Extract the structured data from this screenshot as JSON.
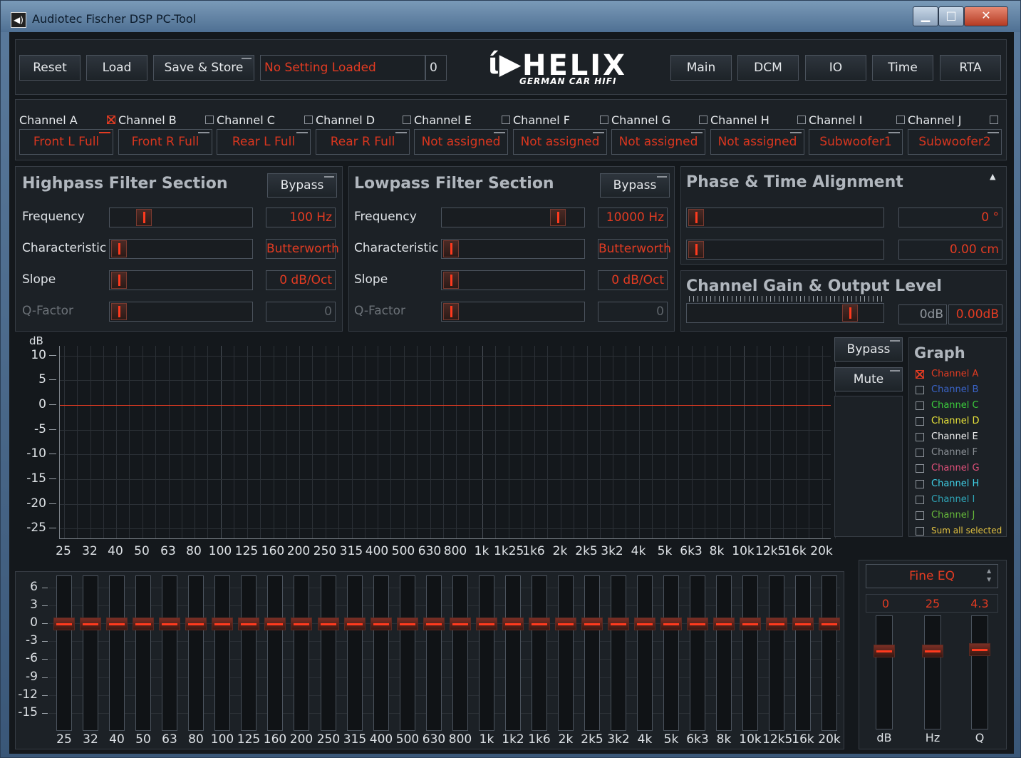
{
  "window": {
    "title": "Audiotec Fischer DSP PC-Tool",
    "minimize": "▁",
    "maximize": "□",
    "close": "✕"
  },
  "toolbar": {
    "reset": "Reset",
    "load": "Load",
    "save_store": "Save & Store",
    "setting_status": "No Setting Loaded",
    "setting_number": "0",
    "nav": [
      "Main",
      "DCM",
      "IO",
      "Time",
      "RTA"
    ]
  },
  "logo": {
    "main": "HELIX",
    "sub": "GERMAN CAR HIFI"
  },
  "channels": [
    {
      "label": "Channel A",
      "checked": true,
      "assignment": "Front L Full"
    },
    {
      "label": "Channel B",
      "checked": false,
      "assignment": "Front R Full"
    },
    {
      "label": "Channel C",
      "checked": false,
      "assignment": "Rear L Full"
    },
    {
      "label": "Channel D",
      "checked": false,
      "assignment": "Rear R Full"
    },
    {
      "label": "Channel E",
      "checked": false,
      "assignment": "Not assigned"
    },
    {
      "label": "Channel F",
      "checked": false,
      "assignment": "Not assigned"
    },
    {
      "label": "Channel G",
      "checked": false,
      "assignment": "Not assigned"
    },
    {
      "label": "Channel H",
      "checked": false,
      "assignment": "Not assigned"
    },
    {
      "label": "Channel I",
      "checked": false,
      "assignment": "Subwoofer1"
    },
    {
      "label": "Channel J",
      "checked": false,
      "assignment": "Subwoofer2"
    }
  ],
  "highpass": {
    "title": "Highpass Filter Section",
    "bypass": "Bypass",
    "rows": [
      {
        "label": "Frequency",
        "value": "100 Hz",
        "level": 0.2
      },
      {
        "label": "Characteristic",
        "value": "Butterworth",
        "level": 0
      },
      {
        "label": "Slope",
        "value": "0 dB/Oct",
        "level": 0
      },
      {
        "label": "Q-Factor",
        "value": "0",
        "level": 0
      }
    ]
  },
  "lowpass": {
    "title": "Lowpass Filter Section",
    "bypass": "Bypass",
    "rows": [
      {
        "label": "Frequency",
        "value": "10000 Hz",
        "level": 0.86
      },
      {
        "label": "Characteristic",
        "value": "Butterworth",
        "level": 0
      },
      {
        "label": "Slope",
        "value": "0 dB/Oct",
        "level": 0
      },
      {
        "label": "Q-Factor",
        "value": "0",
        "level": 0
      }
    ]
  },
  "phase": {
    "title": "Phase & Time Alignment",
    "phase_value": "0 °",
    "time_value": "0.00 cm"
  },
  "gain": {
    "title": "Channel Gain & Output Level",
    "gain_value": "0dB",
    "output_value": "0.00dB"
  },
  "graph": {
    "ylabel": "dB",
    "y_ticks": [
      "10",
      "5",
      "0",
      "-5",
      "-10",
      "-15",
      "-20",
      "-25"
    ],
    "x_ticks": [
      "25",
      "32",
      "40",
      "50",
      "63",
      "80",
      "100",
      "125",
      "160",
      "200",
      "250",
      "315",
      "400",
      "500",
      "630",
      "800",
      "1k",
      "1k25",
      "1k6",
      "2k",
      "2k5",
      "3k2",
      "4k",
      "5k",
      "6k3",
      "8k",
      "10k",
      "12k5",
      "16k",
      "20k"
    ],
    "bypass": "Bypass",
    "mute": "Mute",
    "legend_title": "Graph",
    "legend": [
      {
        "label": "Channel A",
        "color": "#e23b22",
        "checked": true
      },
      {
        "label": "Channel B",
        "color": "#3a64c8",
        "checked": false
      },
      {
        "label": "Channel C",
        "color": "#3ccb3c",
        "checked": false
      },
      {
        "label": "Channel D",
        "color": "#e8e33a",
        "checked": false
      },
      {
        "label": "Channel E",
        "color": "#f2f2f2",
        "checked": false
      },
      {
        "label": "Channel F",
        "color": "#8a8f95",
        "checked": false
      },
      {
        "label": "Channel G",
        "color": "#e0507a",
        "checked": false
      },
      {
        "label": "Channel H",
        "color": "#3fd0e6",
        "checked": false
      },
      {
        "label": "Channel I",
        "color": "#2fa6b8",
        "checked": false
      },
      {
        "label": "Channel J",
        "color": "#66b83a",
        "checked": false
      },
      {
        "label": "Sum all selected",
        "color": "#e0c040",
        "checked": false
      }
    ]
  },
  "eq": {
    "y_ticks": [
      "6",
      "3",
      "0",
      "-3",
      "-6",
      "-9",
      "-12",
      "-15"
    ],
    "bands": [
      "25",
      "32",
      "40",
      "50",
      "63",
      "80",
      "100",
      "125",
      "160",
      "200",
      "250",
      "315",
      "400",
      "500",
      "630",
      "800",
      "1k",
      "1k2",
      "1k6",
      "2k",
      "2k5",
      "3k2",
      "4k",
      "5k",
      "6k3",
      "8k",
      "10k",
      "12k5",
      "16k",
      "20k"
    ],
    "gains": [
      0,
      0,
      0,
      0,
      0,
      0,
      0,
      0,
      0,
      0,
      0,
      0,
      0,
      0,
      0,
      0,
      0,
      0,
      0,
      0,
      0,
      0,
      0,
      0,
      0,
      0,
      0,
      0,
      0,
      0
    ]
  },
  "fine_eq": {
    "title": "Fine EQ",
    "db": "0",
    "hz": "25",
    "q": "4.3",
    "labels": {
      "db": "dB",
      "hz": "Hz",
      "q": "Q"
    }
  }
}
